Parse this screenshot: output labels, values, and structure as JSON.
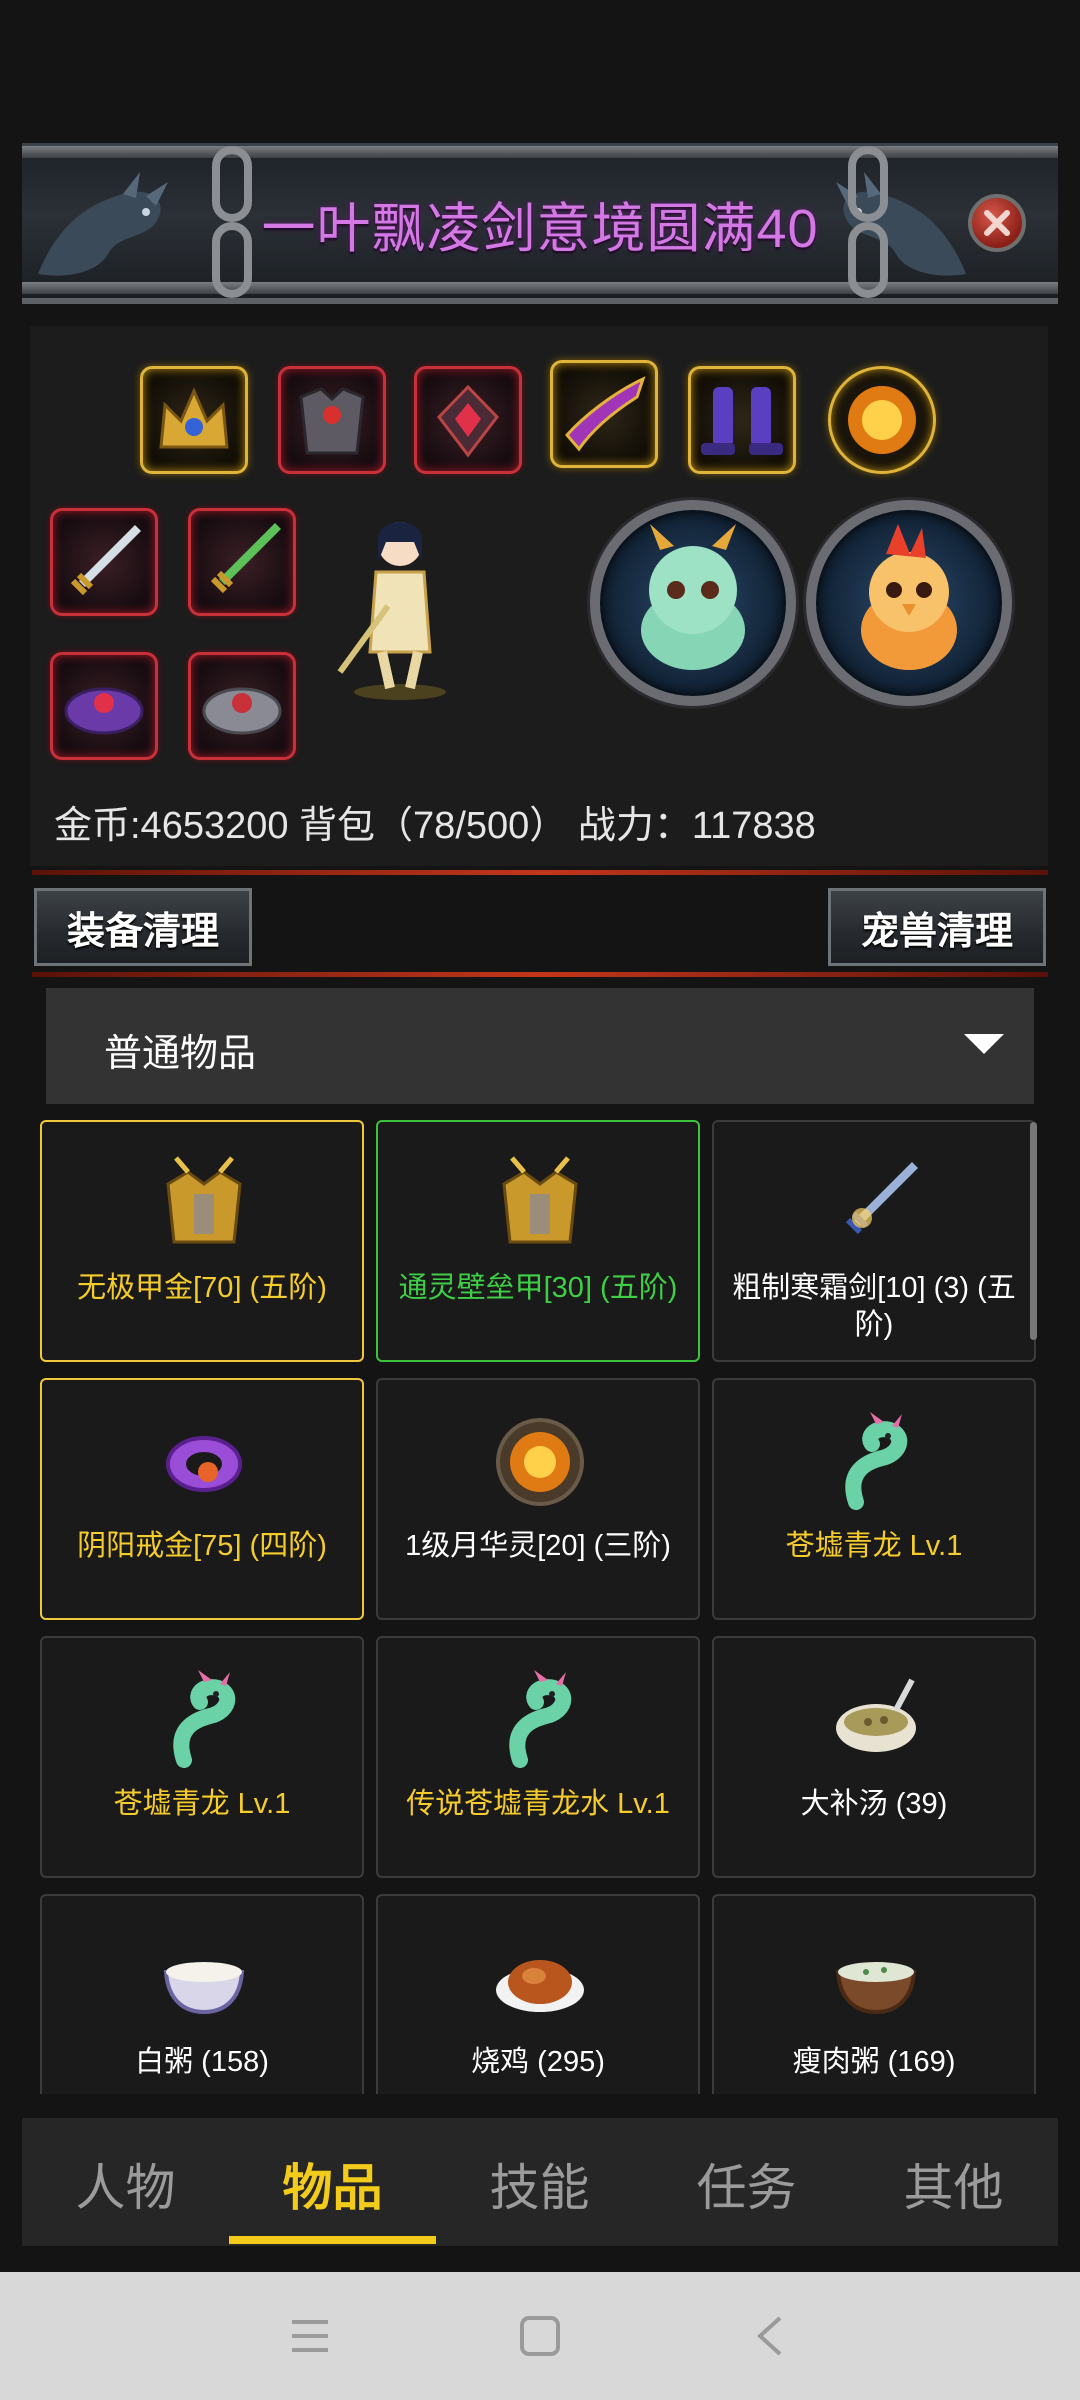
{
  "dialog": {
    "title": "一叶飘凌剑意境圆满40",
    "close_icon": "close-icon"
  },
  "stats": {
    "text": "金币:4653200 背包（78/500） 战力：117838"
  },
  "actions": {
    "equip_clean": "装备清理",
    "pet_clean": "宠兽清理"
  },
  "filter": {
    "selected": "普通物品"
  },
  "items": [
    {
      "name": "无极甲金[70] (五阶)",
      "quality": "gold",
      "icon": "gold-armor-icon"
    },
    {
      "name": "通灵壁垒甲[30] (五阶)",
      "quality": "green",
      "icon": "gold-armor-icon"
    },
    {
      "name": "粗制寒霜剑[10] (3) (五阶)",
      "quality": "white",
      "icon": "sword-icon"
    },
    {
      "name": "阴阳戒金[75] (四阶)",
      "quality": "gold",
      "icon": "ring-icon"
    },
    {
      "name": "1级月华灵[20] (三阶)",
      "quality": "white",
      "icon": "fire-orb-icon"
    },
    {
      "name": "苍墟青龙 Lv.1",
      "quality": "gold-text",
      "icon": "dragon-icon"
    },
    {
      "name": "苍墟青龙 Lv.1",
      "quality": "gold-text",
      "icon": "dragon-icon"
    },
    {
      "name": "传说苍墟青龙水 Lv.1",
      "quality": "gold-text",
      "icon": "dragon-icon"
    },
    {
      "name": "大补汤 (39)",
      "quality": "white",
      "icon": "soup-icon"
    },
    {
      "name": "白粥 (158)",
      "quality": "white",
      "icon": "white-porridge-icon"
    },
    {
      "name": "烧鸡 (295)",
      "quality": "white",
      "icon": "roast-chicken-icon"
    },
    {
      "name": "瘦肉粥 (169)",
      "quality": "white",
      "icon": "meat-porridge-icon"
    }
  ],
  "tabs": [
    {
      "label": "人物",
      "active": false
    },
    {
      "label": "物品",
      "active": true
    },
    {
      "label": "技能",
      "active": false
    },
    {
      "label": "任务",
      "active": false
    },
    {
      "label": "其他",
      "active": false
    }
  ],
  "colors": {
    "title": "#d478e6",
    "active_tab": "#f3cc1b",
    "gold": "#f6cc2c",
    "green": "#3fcf46"
  }
}
